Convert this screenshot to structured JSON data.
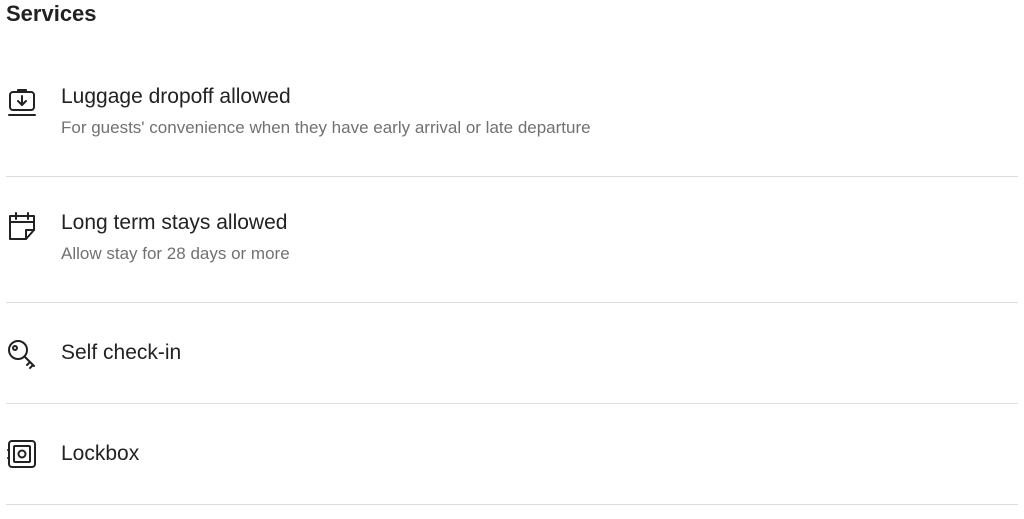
{
  "section": {
    "title": "Services"
  },
  "services": [
    {
      "icon": "luggage-dropoff-icon",
      "label": "Luggage dropoff allowed",
      "description": "For guests' convenience when they have early arrival or late departure"
    },
    {
      "icon": "calendar-icon",
      "label": "Long term stays allowed",
      "description": "Allow stay for 28 days or more"
    },
    {
      "icon": "key-icon",
      "label": "Self check-in",
      "description": ""
    },
    {
      "icon": "lockbox-icon",
      "label": "Lockbox",
      "description": ""
    }
  ],
  "colors": {
    "text": "#222222",
    "secondary_text": "#717171",
    "divider": "#dddddd"
  }
}
